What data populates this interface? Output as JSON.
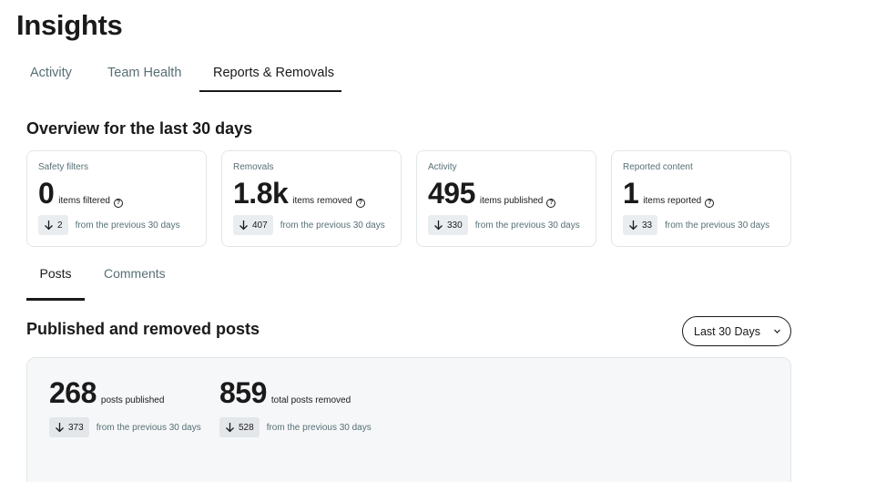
{
  "page_title": "Insights",
  "tabs": [
    {
      "label": "Activity"
    },
    {
      "label": "Team Health"
    },
    {
      "label": "Reports & Removals"
    }
  ],
  "overview": {
    "title": "Overview for the last 30 days",
    "cards": [
      {
        "label": "Safety filters",
        "value": "0",
        "unit": "items filtered",
        "delta": "2",
        "delta_text": "from the previous 30 days"
      },
      {
        "label": "Removals",
        "value": "1.8k",
        "unit": "items removed",
        "delta": "407",
        "delta_text": "from the previous 30 days"
      },
      {
        "label": "Activity",
        "value": "495",
        "unit": "items published",
        "delta": "330",
        "delta_text": "from the previous 30 days"
      },
      {
        "label": "Reported content",
        "value": "1",
        "unit": "items reported",
        "delta": "33",
        "delta_text": "from the previous 30 days"
      }
    ]
  },
  "subtabs": [
    {
      "label": "Posts"
    },
    {
      "label": "Comments"
    }
  ],
  "published_section": {
    "title": "Published and removed posts",
    "range_select": "Last 30 Days",
    "stats": [
      {
        "value": "268",
        "unit": "posts published",
        "delta": "373",
        "delta_text": "from the previous 30 days"
      },
      {
        "value": "859",
        "unit": "total posts removed",
        "delta": "528",
        "delta_text": "from the previous 30 days"
      }
    ]
  },
  "icons": {
    "info": "info-circle-icon",
    "delta_down": "arrow-down-icon",
    "dropdown": "chevron-down-icon"
  }
}
